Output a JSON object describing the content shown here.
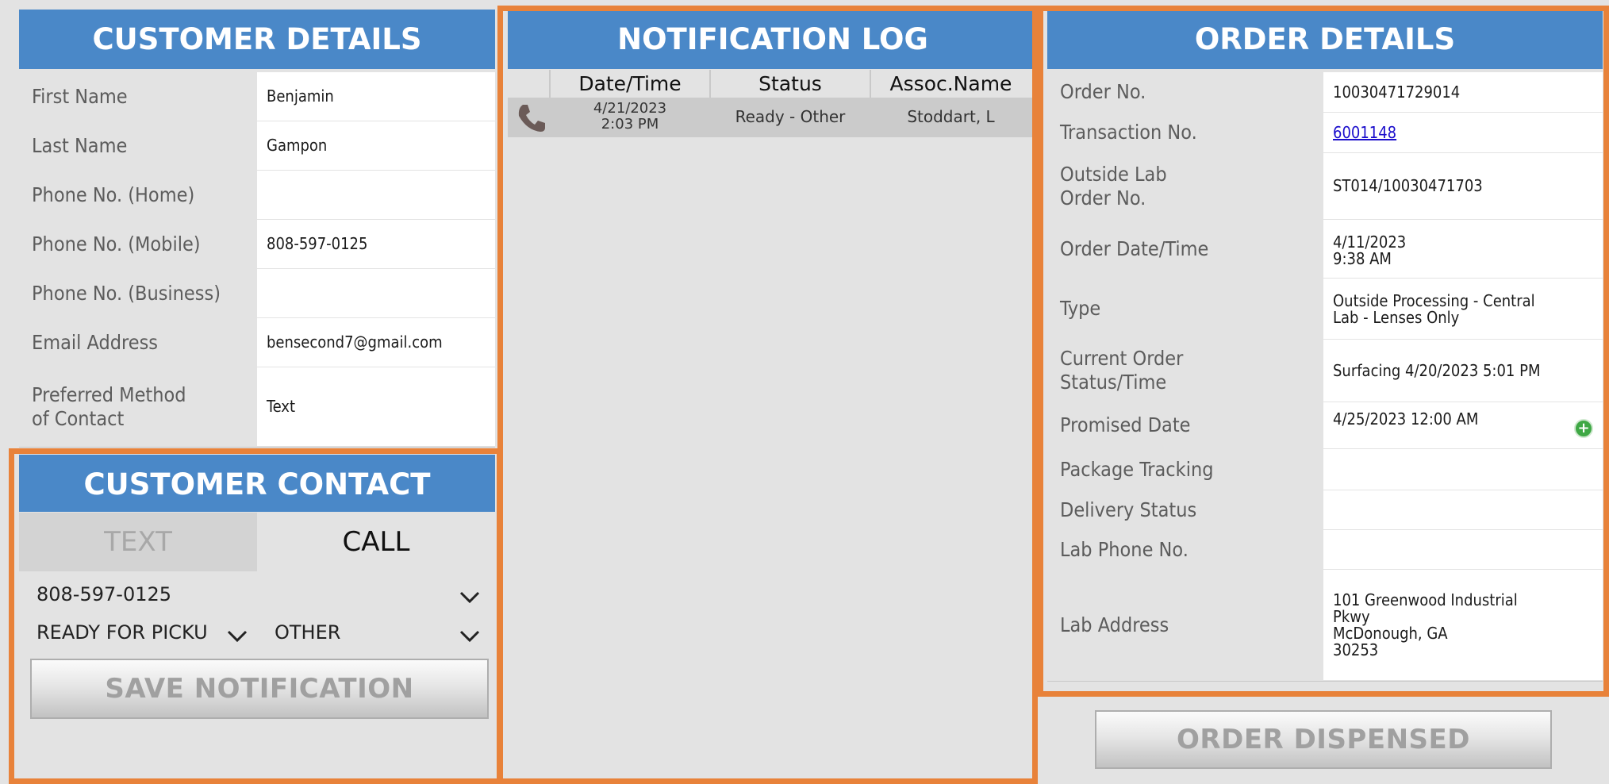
{
  "customer_details": {
    "title": "CUSTOMER DETAILS",
    "rows": [
      {
        "label": "First Name",
        "value": "Benjamin"
      },
      {
        "label": "Last Name",
        "value": "Gampon"
      },
      {
        "label": "Phone No. (Home)",
        "value": ""
      },
      {
        "label": "Phone No. (Mobile)",
        "value": "808-597-0125"
      },
      {
        "label": "Phone No. (Business)",
        "value": ""
      },
      {
        "label": "Email Address",
        "value": "bensecond7@gmail.com"
      },
      {
        "label": "Preferred Method\nof Contact",
        "value": "Text"
      }
    ]
  },
  "customer_contact": {
    "title": "CUSTOMER CONTACT",
    "tab_text": "TEXT",
    "tab_call": "CALL",
    "phone_select": "808-597-0125",
    "reason_select": "READY FOR PICKU",
    "type_select": "OTHER",
    "save_button": "SAVE NOTIFICATION"
  },
  "notification_log": {
    "title": "NOTIFICATION LOG",
    "columns": [
      "Date/Time",
      "Status",
      "Assoc.Name"
    ],
    "rows": [
      {
        "icon": "phone-icon",
        "date": "4/21/2023",
        "time": "2:03 PM",
        "status": "Ready - Other",
        "assoc": "Stoddart, L"
      }
    ]
  },
  "order_details": {
    "title": "ORDER DETAILS",
    "rows": [
      {
        "label": "Order No.",
        "value": "10030471729014"
      },
      {
        "label": "Transaction No.",
        "value": "6001148"
      },
      {
        "label": "Outside Lab\nOrder No.",
        "value": "ST014/10030471703"
      },
      {
        "label": "Order Date/Time",
        "value": "4/11/2023\n9:38 AM"
      },
      {
        "label": "Type",
        "value": "Outside Processing - Central\nLab - Lenses Only"
      },
      {
        "label": "Current Order\nStatus/Time",
        "value": "Surfacing 4/20/2023 5:01 PM"
      },
      {
        "label": "Promised Date",
        "value": "4/25/2023 12:00 AM"
      },
      {
        "label": "Package Tracking",
        "value": ""
      },
      {
        "label": "Delivery Status",
        "value": ""
      },
      {
        "label": "Lab Phone No.",
        "value": ""
      },
      {
        "label": "Lab Address",
        "value": "101 Greenwood Industrial\nPkwy\nMcDonough, GA\n30253"
      }
    ],
    "dispense_button": "ORDER DISPENSED"
  },
  "colors": {
    "header": "#4a88c8",
    "highlight_border": "#e8823a",
    "link": "#1a0dcc"
  }
}
